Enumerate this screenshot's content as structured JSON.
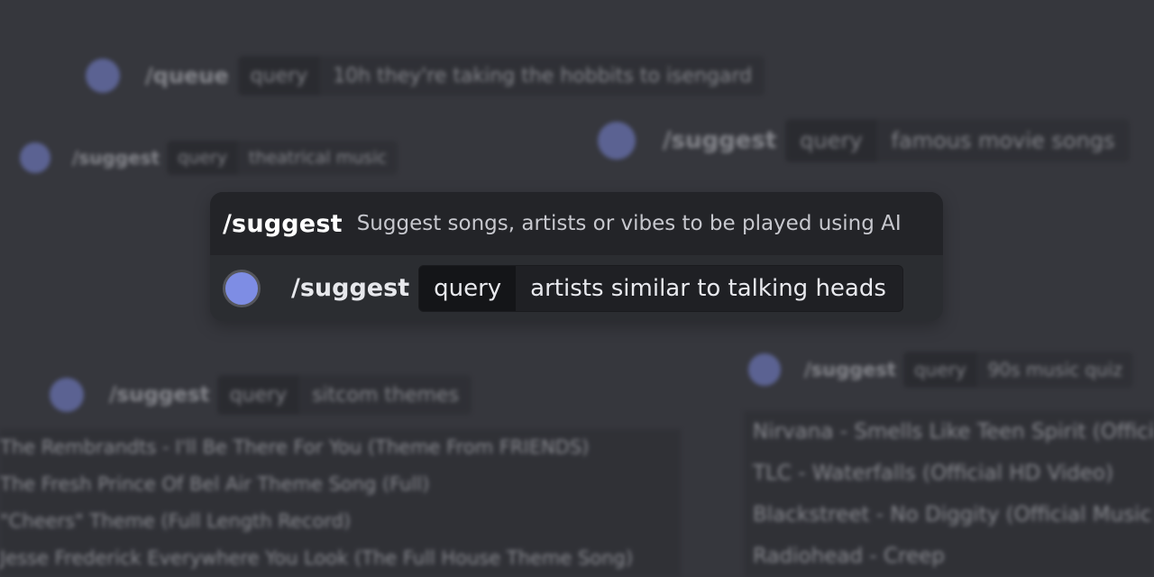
{
  "background_commands": [
    {
      "slash": "/queue",
      "key": "query",
      "value": "10h they're taking the hobbits to isengard"
    },
    {
      "slash": "/suggest",
      "key": "query",
      "value": "theatrical music"
    },
    {
      "slash": "/suggest",
      "key": "query",
      "value": "famous movie songs"
    },
    {
      "slash": "/suggest",
      "key": "query",
      "value": "sitcom themes"
    },
    {
      "slash": "/suggest",
      "key": "query",
      "value": "90s music quiz"
    }
  ],
  "left_results": [
    "The Rembrandts - I'll Be There For You (Theme From FRIENDS)",
    "The Fresh Prince Of Bel Air Theme Song (Full)",
    "\"Cheers\" Theme (Full Length Record)",
    "Jesse Frederick Everywhere You Look (The Full House Theme Song)"
  ],
  "right_results": [
    "Nirvana - Smells Like Teen Spirit (Official",
    "TLC - Waterfalls (Official HD Video)",
    "Blackstreet - No Diggity (Official Music",
    "Radiohead - Creep"
  ],
  "card": {
    "title": "/suggest",
    "description": "Suggest songs, artists or vibes to be played using AI",
    "slash": "/suggest",
    "option_key": "query",
    "option_value": "artists similar to talking heads"
  }
}
